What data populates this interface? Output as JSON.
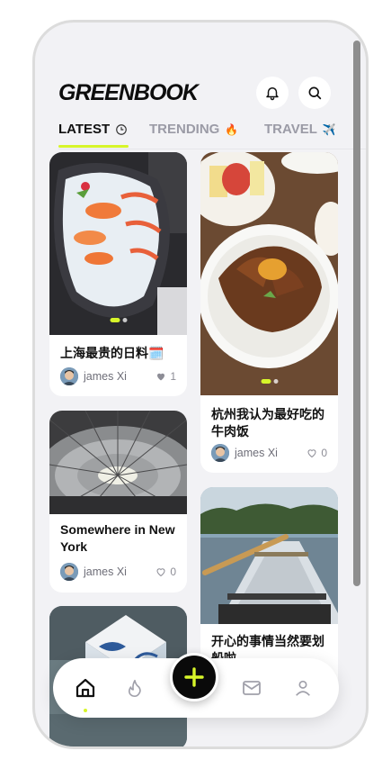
{
  "app": {
    "logo": "GREENBOOK"
  },
  "header": {
    "notifications_icon": "bell-icon",
    "search_icon": "search-icon"
  },
  "tabs": [
    {
      "label": "LATEST",
      "icon": "🕒",
      "active": true
    },
    {
      "label": "TRENDING",
      "icon": "🔥",
      "active": false
    },
    {
      "label": "TRAVEL",
      "icon": "✈️",
      "active": false
    }
  ],
  "posts": [
    {
      "title": "上海最贵的日料🗓️",
      "author": "james Xi",
      "likes": "1",
      "liked": true,
      "photo": "sashimi platter"
    },
    {
      "title": "杭州我认为最好吃的牛肉饭",
      "author": "james Xi",
      "likes": "0",
      "liked": false,
      "photo": "beef rice bowl"
    },
    {
      "title": "Somewhere in New York",
      "author": "james Xi",
      "likes": "0",
      "liked": false,
      "photo": "domed glass ceiling"
    },
    {
      "title": "开心的事情当然要划船啦",
      "author": "",
      "likes": "",
      "liked": false,
      "photo": "rowing boat on lake"
    },
    {
      "title": "",
      "author": "",
      "likes": "",
      "liked": false,
      "photo": "paper cube in hand"
    }
  ],
  "nav": {
    "home_icon": "home-icon",
    "trending_icon": "flame-icon",
    "add_icon": "plus-icon",
    "messages_icon": "mail-icon",
    "profile_icon": "user-icon"
  },
  "colors": {
    "accent": "#d7f52a",
    "background": "#f2f2f5",
    "fab": "#0a0a0a"
  }
}
